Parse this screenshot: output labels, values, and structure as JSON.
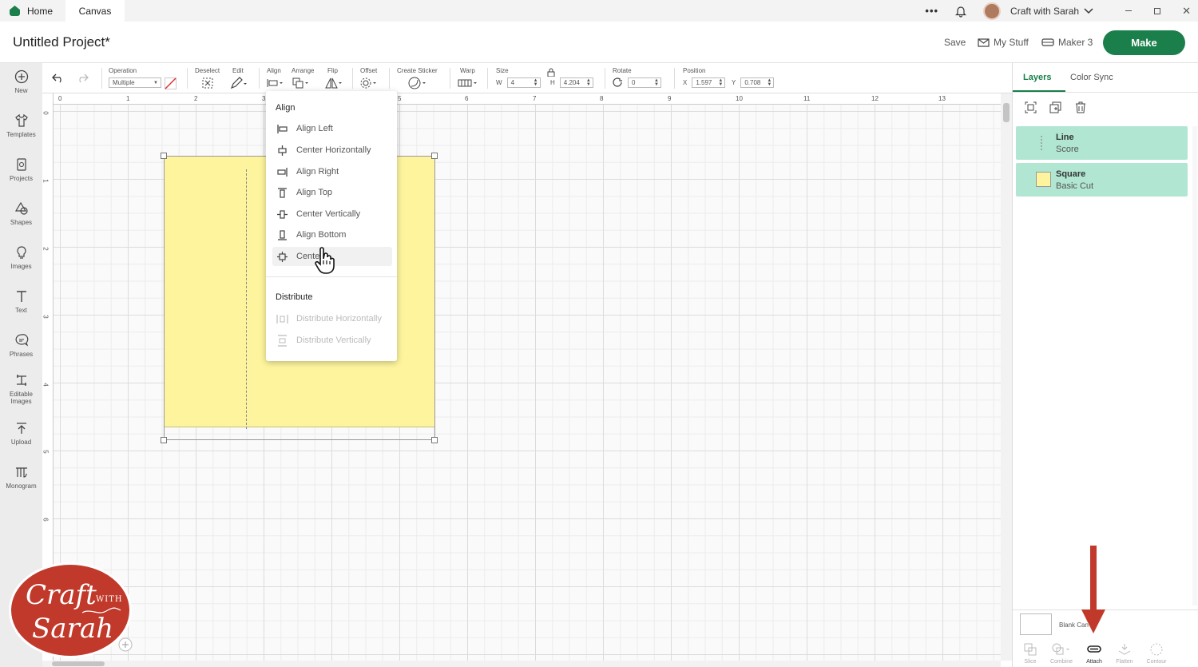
{
  "titlebar": {
    "tab_home": "Home",
    "tab_canvas": "Canvas",
    "more": "•••",
    "user_name": "Craft with Sarah"
  },
  "header": {
    "project_title": "Untitled Project*",
    "save": "Save",
    "my_stuff": "My Stuff",
    "machine": "Maker 3",
    "make": "Make"
  },
  "sidebar": [
    {
      "label": "New",
      "icon": "plus-circle-icon"
    },
    {
      "label": "Templates",
      "icon": "shirt-icon"
    },
    {
      "label": "Projects",
      "icon": "projects-icon"
    },
    {
      "label": "Shapes",
      "icon": "shapes-icon"
    },
    {
      "label": "Images",
      "icon": "lightbulb-icon"
    },
    {
      "label": "Text",
      "icon": "text-icon"
    },
    {
      "label": "Phrases",
      "icon": "speech-bubble-icon"
    },
    {
      "label": "Editable",
      "label2": "Images",
      "icon": "editable-images-icon"
    },
    {
      "label": "Upload",
      "icon": "upload-icon"
    },
    {
      "label": "Monogram",
      "icon": "monogram-icon"
    }
  ],
  "toolbar": {
    "operation_label": "Operation",
    "operation_value": "Multiple",
    "deselect": "Deselect",
    "edit": "Edit",
    "align": "Align",
    "arrange": "Arrange",
    "flip": "Flip",
    "offset": "Offset",
    "create_sticker": "Create Sticker",
    "warp": "Warp",
    "size": "Size",
    "w_label": "W",
    "w_value": "4",
    "h_label": "H",
    "h_value": "4.204",
    "rotate": "Rotate",
    "rotate_value": "0",
    "position": "Position",
    "x_label": "X",
    "x_value": "1.597",
    "y_label": "Y",
    "y_value": "0.708"
  },
  "ruler": {
    "top": [
      "0",
      "1",
      "2",
      "3",
      "5",
      "6",
      "7",
      "8",
      "9",
      "10",
      "11",
      "12",
      "13"
    ],
    "left": [
      "0",
      "1",
      "2",
      "3",
      "4",
      "5",
      "6"
    ]
  },
  "dropdown": {
    "align_heading": "Align",
    "align_items": [
      "Align Left",
      "Center Horizontally",
      "Align Right",
      "Align Top",
      "Center Vertically",
      "Align Bottom",
      "Cente"
    ],
    "distribute_heading": "Distribute",
    "distribute_items": [
      "Distribute Horizontally",
      "Distribute Vertically"
    ]
  },
  "panel": {
    "tab_layers": "Layers",
    "tab_color_sync": "Color Sync",
    "layers": [
      {
        "name": "Line",
        "type": "Score"
      },
      {
        "name": "Square",
        "type": "Basic Cut",
        "color": "#fdf49d"
      }
    ],
    "blank_canvas": "Blank Can",
    "bottom": [
      "Slice",
      "Combine",
      "Attach",
      "Flatten",
      "Contour"
    ]
  },
  "logo": {
    "line1": "Craft",
    "with": "WITH",
    "line2": "Sarah"
  },
  "colors": {
    "brand": "#1a7f4b",
    "layer_bg": "#b1e6d2",
    "square": "#fdf49d",
    "arrow": "#c0392b"
  }
}
